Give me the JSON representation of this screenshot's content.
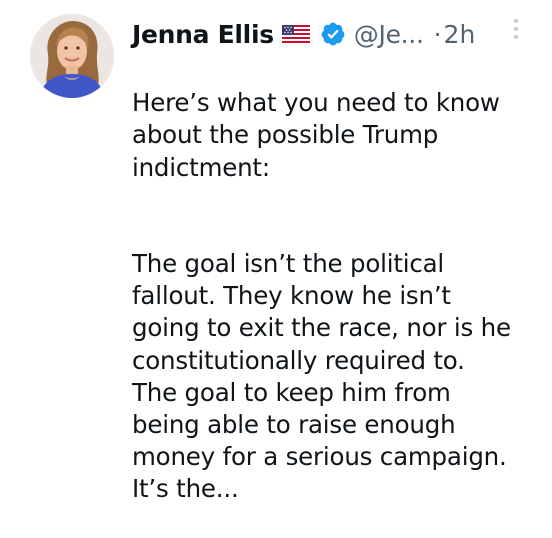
{
  "author": {
    "display_name": "Jenna Ellis",
    "flag_icon": "us-flag-icon",
    "verified_icon": "verified-badge-icon",
    "verified_color": "#1d9bf0",
    "handle": "@Je...",
    "separator": "·",
    "timestamp": "2h"
  },
  "menu": {
    "icon": "more-options-icon"
  },
  "tweet": {
    "paragraphs": [
      "Here’s what you need to know\nabout the possible Trump\nindictment:",
      "The goal isn’t the political\nfallout. They know he isn’t\ngoing to exit the race, nor is he\nconstitutionally required to.\nThe goal to keep him from\nbeing able to raise enough\nmoney for a serious campaign.\nIt’s the..."
    ]
  },
  "colors": {
    "text_primary": "#0f1419",
    "text_secondary": "#536471",
    "background": "#ffffff"
  }
}
